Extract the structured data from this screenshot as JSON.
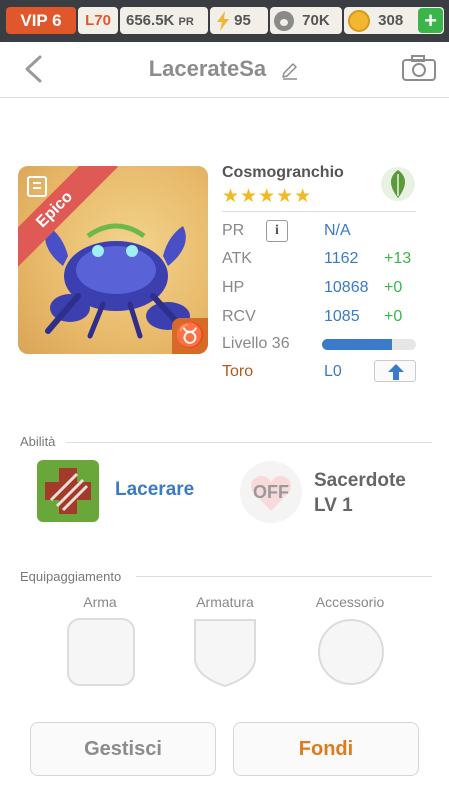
{
  "topbar": {
    "vip": "VIP 6",
    "level": "L70",
    "power": "656.5K",
    "power_unit": "PR",
    "energy": "95",
    "food": "70K",
    "coins": "308",
    "plus": "+"
  },
  "header": {
    "title": "LacerateSa"
  },
  "monster": {
    "rarity": "Epico",
    "name": "Cosmogranchio",
    "stars": "★★★★★",
    "star_count": 5,
    "element": "leaf-icon",
    "zodiac": "♉"
  },
  "stats": {
    "pr_label": "PR",
    "pr_info": "i",
    "pr_value": "N/A",
    "atk_label": "ATK",
    "atk_value": "1162",
    "atk_bonus": "+13",
    "hp_label": "HP",
    "hp_value": "10868",
    "hp_bonus": "+0",
    "rcv_label": "RCV",
    "rcv_value": "1085",
    "rcv_bonus": "+0",
    "level_label": "Livello 36",
    "level_progress": 0.74,
    "sign_label": "Toro",
    "sign_value": "L0"
  },
  "abilities": {
    "title": "Abilità",
    "skill_name": "Lacerare",
    "leader_state": "OFF",
    "leader_name": "Sacerdote",
    "leader_level": "LV 1"
  },
  "equipment": {
    "title": "Equipaggiamento",
    "weapon": "Arma",
    "armor": "Armatura",
    "accessory": "Accessorio"
  },
  "actions": {
    "manage": "Gestisci",
    "fuse": "Fondi"
  },
  "colors": {
    "accent_blue": "#3a7bc8",
    "accent_orange": "#e07a1e",
    "vip_red": "#e0572c",
    "bonus_green": "#3bb54a"
  }
}
